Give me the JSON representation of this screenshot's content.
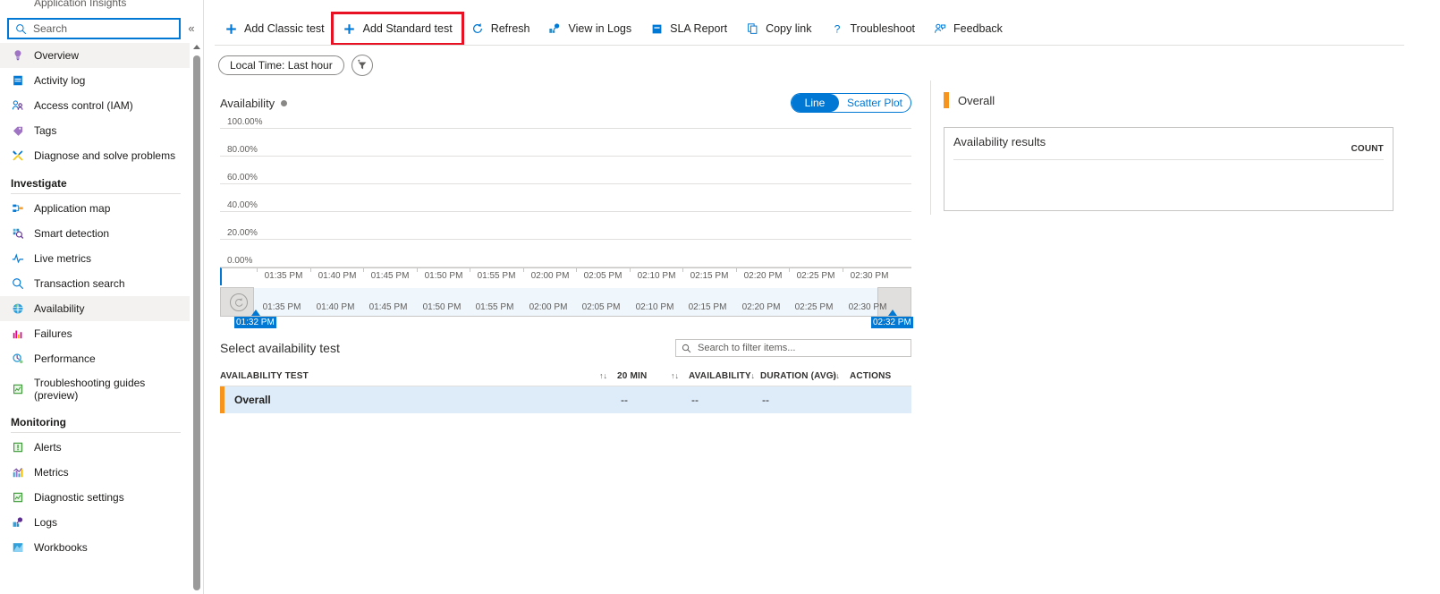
{
  "sidebar": {
    "title": "Application Insights",
    "search": {
      "placeholder": "Search",
      "value": "",
      "icon": "search-icon"
    },
    "collapse_icon": "chevron-double-left-icon",
    "items": [
      {
        "label": "Overview",
        "icon": "lightbulb-icon",
        "selected": true
      },
      {
        "label": "Activity log",
        "icon": "activity-log-icon",
        "selected": false
      },
      {
        "label": "Access control (IAM)",
        "icon": "people-icon",
        "selected": false
      },
      {
        "label": "Tags",
        "icon": "tag-icon",
        "selected": false
      },
      {
        "label": "Diagnose and solve problems",
        "icon": "wrench-icon",
        "selected": false
      }
    ],
    "groups": [
      {
        "title": "Investigate",
        "items": [
          {
            "label": "Application map",
            "icon": "app-map-icon",
            "selected": false
          },
          {
            "label": "Smart detection",
            "icon": "smart-detection-icon",
            "selected": false
          },
          {
            "label": "Live metrics",
            "icon": "live-metrics-icon",
            "selected": false
          },
          {
            "label": "Transaction search",
            "icon": "search-icon",
            "selected": false
          },
          {
            "label": "Availability",
            "icon": "globe-icon",
            "selected": true
          },
          {
            "label": "Failures",
            "icon": "failures-icon",
            "selected": false
          },
          {
            "label": "Performance",
            "icon": "performance-icon",
            "selected": false
          },
          {
            "label": "Troubleshooting guides (preview)",
            "icon": "guide-icon",
            "selected": false
          }
        ]
      },
      {
        "title": "Monitoring",
        "items": [
          {
            "label": "Alerts",
            "icon": "alert-icon",
            "selected": false
          },
          {
            "label": "Metrics",
            "icon": "metrics-icon",
            "selected": false
          },
          {
            "label": "Diagnostic settings",
            "icon": "diagnostic-icon",
            "selected": false
          },
          {
            "label": "Logs",
            "icon": "logs-icon",
            "selected": false
          },
          {
            "label": "Workbooks",
            "icon": "workbooks-icon",
            "selected": false
          }
        ]
      }
    ]
  },
  "toolbar": {
    "commands": [
      {
        "label": "Add Classic test",
        "icon": "plus-icon",
        "highlighted": false
      },
      {
        "label": "Add Standard test",
        "icon": "plus-icon",
        "highlighted": true
      },
      {
        "label": "Refresh",
        "icon": "refresh-icon",
        "highlighted": false
      },
      {
        "label": "View in Logs",
        "icon": "view-in-logs-icon",
        "highlighted": false
      },
      {
        "label": "SLA Report",
        "icon": "sla-report-icon",
        "highlighted": false
      },
      {
        "label": "Copy link",
        "icon": "copy-icon",
        "highlighted": false
      },
      {
        "label": "Troubleshoot",
        "icon": "question-icon",
        "highlighted": false
      },
      {
        "label": "Feedback",
        "icon": "feedback-icon",
        "highlighted": false
      }
    ],
    "highlight_color": "#e81123"
  },
  "filters": {
    "time_pill": "Local Time: Last hour",
    "add_filter_icon": "add-filter-icon"
  },
  "chart_data": {
    "type": "line",
    "title": "Availability",
    "xlabel": "",
    "ylabel": "",
    "ylim": [
      0,
      100
    ],
    "yticks": [
      "0.00%",
      "20.00%",
      "40.00%",
      "60.00%",
      "80.00%",
      "100.00%"
    ],
    "xticks": [
      "01:35 PM",
      "01:40 PM",
      "01:45 PM",
      "01:50 PM",
      "01:55 PM",
      "02:00 PM",
      "02:05 PM",
      "02:10 PM",
      "02:15 PM",
      "02:20 PM",
      "02:25 PM",
      "02:30 PM"
    ],
    "series": [
      {
        "name": "Overall",
        "values": [],
        "color": "#f7941e"
      }
    ],
    "grid": true,
    "legend": "none",
    "empty": true,
    "view_modes": [
      {
        "label": "Line",
        "selected": true
      },
      {
        "label": "Scatter Plot",
        "selected": false
      }
    ],
    "range_selector": {
      "start_label": "01:32 PM",
      "end_label": "02:32 PM",
      "ticks": [
        "01:35 PM",
        "01:40 PM",
        "01:45 PM",
        "01:50 PM",
        "01:55 PM",
        "02:00 PM",
        "02:05 PM",
        "02:10 PM",
        "02:15 PM",
        "02:20 PM",
        "02:25 PM",
        "02:30 PM"
      ],
      "reset_icon": "reset-zoom-icon"
    }
  },
  "test_table": {
    "heading": "Select availability test",
    "filter": {
      "placeholder": "Search to filter items...",
      "value": "",
      "icon": "search-icon"
    },
    "columns": [
      "AVAILABILITY TEST",
      "20 MIN",
      "AVAILABILITY",
      "DURATION (AVG)",
      "ACTIONS"
    ],
    "sort_icon": "sort-arrows-icon",
    "rows": [
      {
        "name": "Overall",
        "twenty_min": "--",
        "availability": "--",
        "duration": "--",
        "actions": "",
        "accent": "#f7941e",
        "selected": true
      }
    ]
  },
  "right_panel": {
    "title": "Overall",
    "accent": "#f7941e",
    "card": {
      "title": "Availability results",
      "count_header": "COUNT",
      "rows": []
    }
  }
}
